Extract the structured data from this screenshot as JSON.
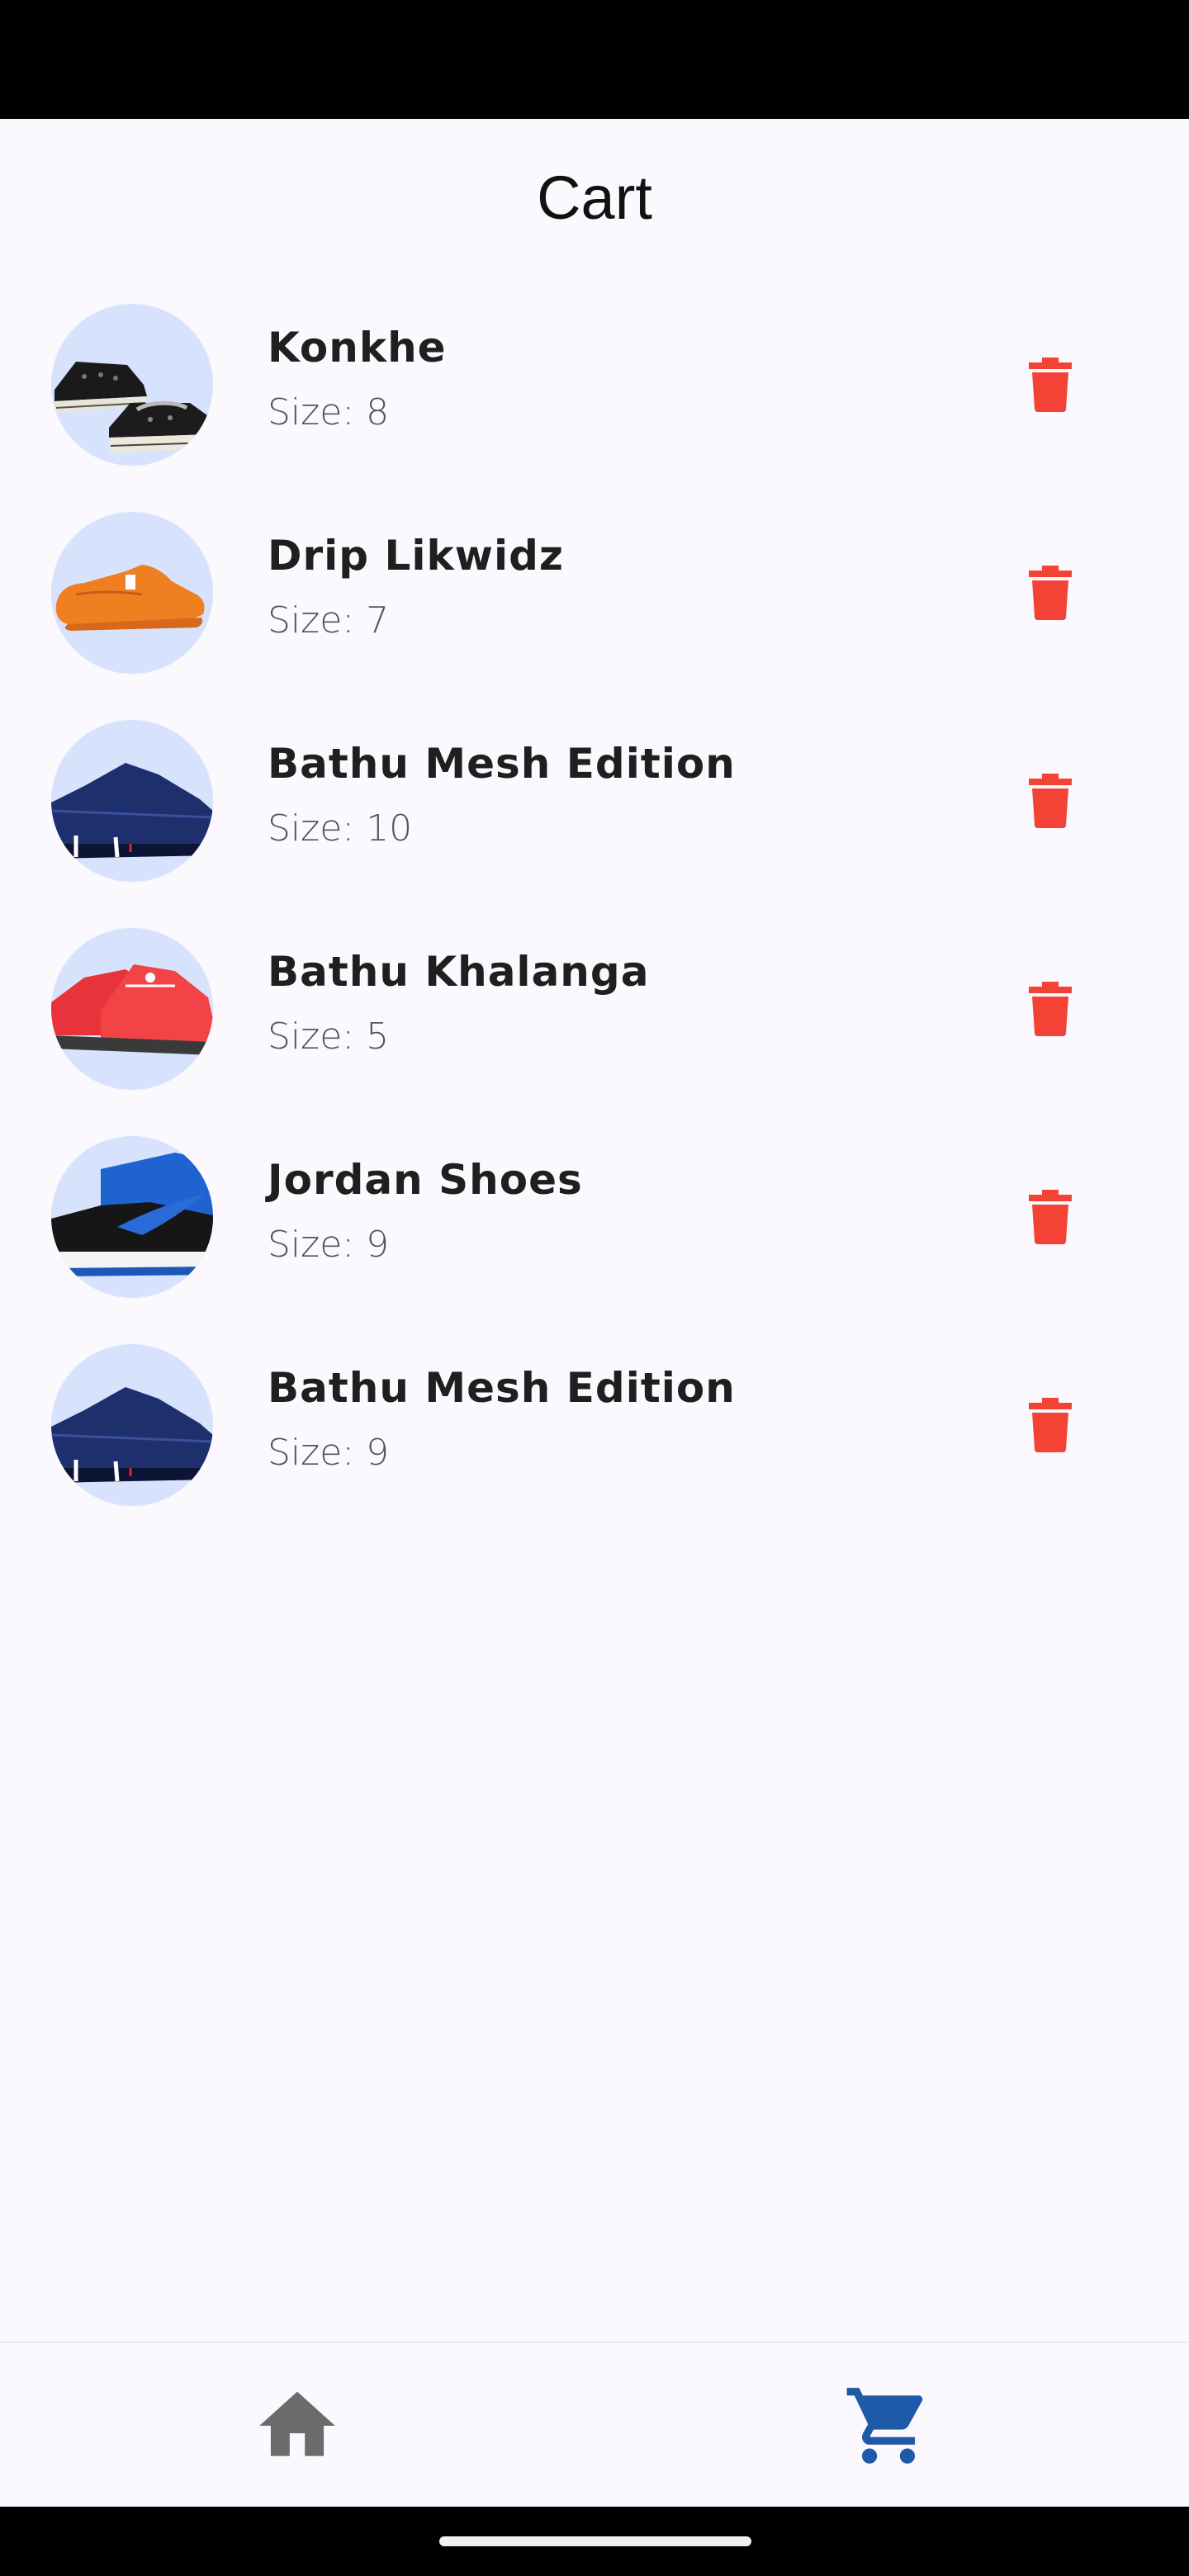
{
  "header": {
    "title": "Cart"
  },
  "cart": {
    "items": [
      {
        "name": "Konkhe",
        "size": "Size: 8",
        "image": "black-platform-sneakers"
      },
      {
        "name": "Drip Likwidz",
        "size": "Size: 7",
        "image": "orange-knit-sneaker"
      },
      {
        "name": "Bathu Mesh Edition",
        "size": "Size: 10",
        "image": "navy-mesh-sneaker"
      },
      {
        "name": "Bathu Khalanga",
        "size": "Size: 5",
        "image": "red-knit-sneakers"
      },
      {
        "name": "Jordan Shoes",
        "size": "Size: 9",
        "image": "blue-black-high-top"
      },
      {
        "name": "Bathu Mesh Edition",
        "size": "Size: 9",
        "image": "navy-mesh-sneaker"
      }
    ]
  },
  "nav": {
    "items": [
      {
        "icon": "home-icon",
        "active": false
      },
      {
        "icon": "cart-icon",
        "active": true
      }
    ]
  },
  "colors": {
    "delete": "#f44336",
    "nav_active": "#1e5aa8",
    "nav_inactive": "#6b6b6b",
    "thumb_bg": "#d7e3fc",
    "background": "#fcf9fe"
  }
}
